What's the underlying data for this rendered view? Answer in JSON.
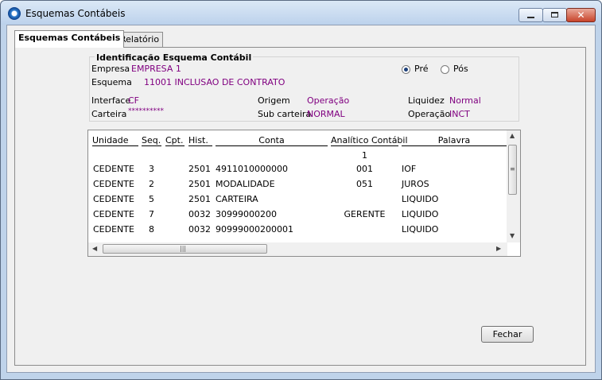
{
  "window": {
    "title": "Esquemas Contábeis"
  },
  "tabs": [
    {
      "label": "Esquemas Contábeis"
    },
    {
      "label": "Relatório"
    }
  ],
  "group": {
    "title": "Identificação Esquema Contábil"
  },
  "fields": {
    "empresa": {
      "label": "Empresa",
      "value": "EMPRESA 1"
    },
    "esquema": {
      "label": "Esquema",
      "value": "11001  INCLUSAO DE CONTRATO"
    },
    "interface": {
      "label": "Interface",
      "value": "CF"
    },
    "carteira": {
      "label": "Carteira",
      "value": "**********"
    },
    "origem": {
      "label": "Origem",
      "value": "Operação"
    },
    "subcarteira": {
      "label": "Sub carteira",
      "value": "NORMAL"
    },
    "liquidez": {
      "label": "Liquidez",
      "value": "Normal"
    },
    "operacao": {
      "label": "Operação",
      "value": "INCT"
    }
  },
  "radios": {
    "pre": {
      "label": "Pré",
      "selected": true
    },
    "pos": {
      "label": "Pós",
      "selected": false
    }
  },
  "table": {
    "headers": [
      "Unidade",
      "Seq.",
      "Cpt.",
      "Hist.",
      "Conta",
      "Analítico Contábil",
      "Palavra"
    ],
    "subheader_value": "1",
    "rows": [
      [
        "CEDENTE",
        "3",
        "",
        "2501",
        "4911010000000",
        "001",
        "IOF"
      ],
      [
        "CEDENTE",
        "2",
        "",
        "2501",
        "MODALIDADE",
        "051",
        "JUROS"
      ],
      [
        "CEDENTE",
        "5",
        "",
        "2501",
        "CARTEIRA",
        "",
        "LIQUIDO"
      ],
      [
        "CEDENTE",
        "7",
        "",
        "0032",
        "30999000200",
        "GERENTE",
        "LIQUIDO"
      ],
      [
        "CEDENTE",
        "8",
        "",
        "0032",
        "90999000200001",
        "",
        "LIQUIDO"
      ]
    ]
  },
  "buttons": {
    "fechar": "Fechar"
  },
  "colors": {
    "value_text": "#800080",
    "accent": "#1c3f7a"
  },
  "icons": {
    "app": "app-icon",
    "minimize": "minimize-icon",
    "maximize": "maximize-icon",
    "close": "close-icon"
  }
}
